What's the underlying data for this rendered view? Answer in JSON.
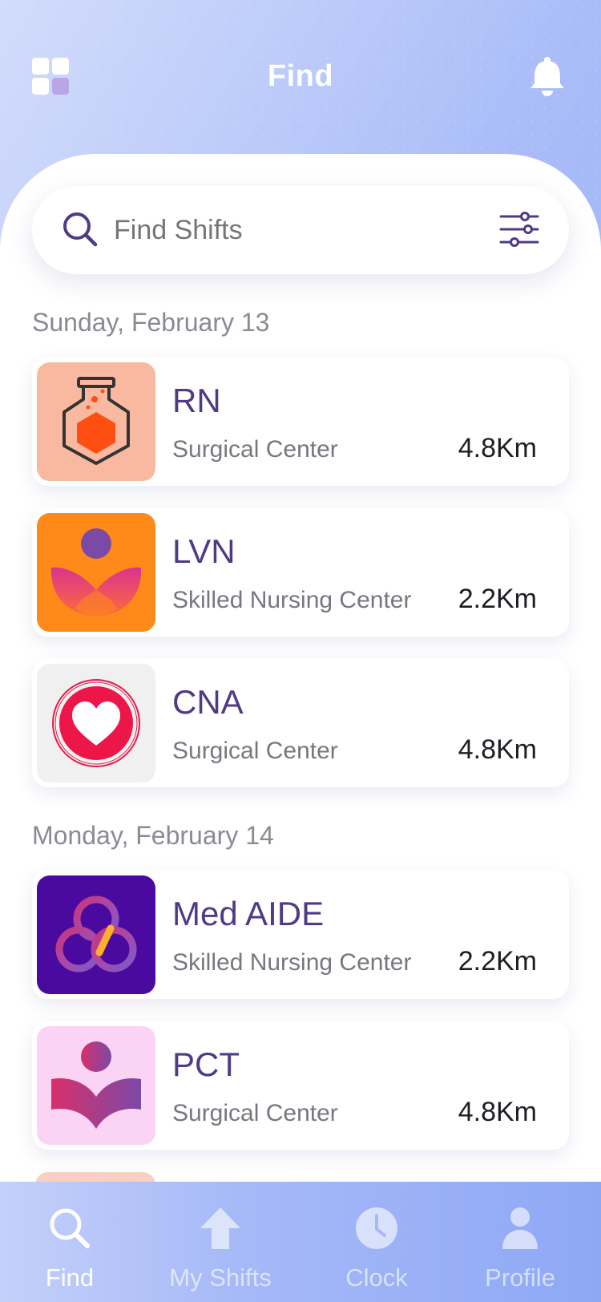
{
  "header": {
    "title": "Find"
  },
  "search": {
    "placeholder": "Find Shifts"
  },
  "sections": [
    {
      "date": "Sunday, February 13",
      "shifts": [
        {
          "role": "RN",
          "place": "Surgical Center",
          "distance": "4.8Km",
          "icon": "flask-icon",
          "color": "#f9b8a0"
        },
        {
          "role": "LVN",
          "place": "Skilled Nursing Center",
          "distance": "2.2Km",
          "icon": "lotus-person-icon",
          "color": "#ff8a1a"
        },
        {
          "role": "CNA",
          "place": "Surgical Center",
          "distance": "4.8Km",
          "icon": "heart-icon",
          "color": "#f0f0f0"
        }
      ]
    },
    {
      "date": "Monday, February 14",
      "shifts": [
        {
          "role": "Med AIDE",
          "place": "Skilled Nursing Center",
          "distance": "2.2Km",
          "icon": "trefoil-icon",
          "color": "#4a0aa0"
        },
        {
          "role": "PCT",
          "place": "Surgical Center",
          "distance": "4.8Km",
          "icon": "person-book-icon",
          "color": "#fbd4f5"
        }
      ]
    }
  ],
  "nav": {
    "items": [
      {
        "label": "Find",
        "icon": "search-icon",
        "active": true
      },
      {
        "label": "My Shifts",
        "icon": "arrow-up-icon",
        "active": false
      },
      {
        "label": "Clock",
        "icon": "clock-icon",
        "active": false
      },
      {
        "label": "Profile",
        "icon": "person-icon",
        "active": false
      }
    ]
  }
}
